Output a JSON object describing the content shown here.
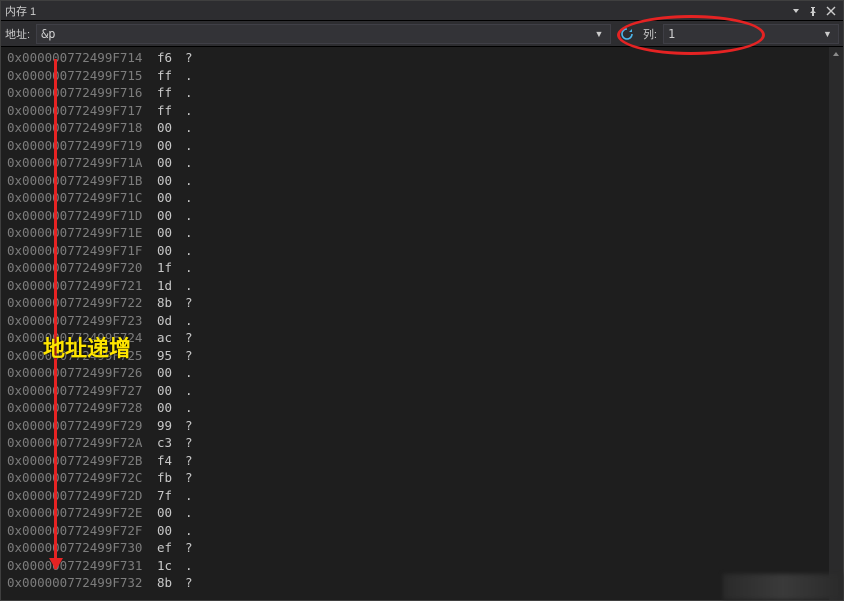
{
  "title": "内存 1",
  "toolbar": {
    "address_label": "地址:",
    "address_value": "&p",
    "columns_label": "列:",
    "columns_value": "1"
  },
  "annotation": {
    "text": "地址递增"
  },
  "memory_rows": [
    {
      "address": "0x000000772499F714",
      "hex": "f6",
      "ascii": "?"
    },
    {
      "address": "0x000000772499F715",
      "hex": "ff",
      "ascii": "."
    },
    {
      "address": "0x000000772499F716",
      "hex": "ff",
      "ascii": "."
    },
    {
      "address": "0x000000772499F717",
      "hex": "ff",
      "ascii": "."
    },
    {
      "address": "0x000000772499F718",
      "hex": "00",
      "ascii": "."
    },
    {
      "address": "0x000000772499F719",
      "hex": "00",
      "ascii": "."
    },
    {
      "address": "0x000000772499F71A",
      "hex": "00",
      "ascii": "."
    },
    {
      "address": "0x000000772499F71B",
      "hex": "00",
      "ascii": "."
    },
    {
      "address": "0x000000772499F71C",
      "hex": "00",
      "ascii": "."
    },
    {
      "address": "0x000000772499F71D",
      "hex": "00",
      "ascii": "."
    },
    {
      "address": "0x000000772499F71E",
      "hex": "00",
      "ascii": "."
    },
    {
      "address": "0x000000772499F71F",
      "hex": "00",
      "ascii": "."
    },
    {
      "address": "0x000000772499F720",
      "hex": "1f",
      "ascii": "."
    },
    {
      "address": "0x000000772499F721",
      "hex": "1d",
      "ascii": "."
    },
    {
      "address": "0x000000772499F722",
      "hex": "8b",
      "ascii": "?"
    },
    {
      "address": "0x000000772499F723",
      "hex": "0d",
      "ascii": "."
    },
    {
      "address": "0x000000772499F724",
      "hex": "ac",
      "ascii": "?"
    },
    {
      "address": "0x000000772499F725",
      "hex": "95",
      "ascii": "?"
    },
    {
      "address": "0x000000772499F726",
      "hex": "00",
      "ascii": "."
    },
    {
      "address": "0x000000772499F727",
      "hex": "00",
      "ascii": "."
    },
    {
      "address": "0x000000772499F728",
      "hex": "00",
      "ascii": "."
    },
    {
      "address": "0x000000772499F729",
      "hex": "99",
      "ascii": "?"
    },
    {
      "address": "0x000000772499F72A",
      "hex": "c3",
      "ascii": "?"
    },
    {
      "address": "0x000000772499F72B",
      "hex": "f4",
      "ascii": "?"
    },
    {
      "address": "0x000000772499F72C",
      "hex": "fb",
      "ascii": "?"
    },
    {
      "address": "0x000000772499F72D",
      "hex": "7f",
      "ascii": "."
    },
    {
      "address": "0x000000772499F72E",
      "hex": "00",
      "ascii": "."
    },
    {
      "address": "0x000000772499F72F",
      "hex": "00",
      "ascii": "."
    },
    {
      "address": "0x000000772499F730",
      "hex": "ef",
      "ascii": "?"
    },
    {
      "address": "0x000000772499F731",
      "hex": "1c",
      "ascii": "."
    },
    {
      "address": "0x000000772499F732",
      "hex": "8b",
      "ascii": "?"
    }
  ]
}
